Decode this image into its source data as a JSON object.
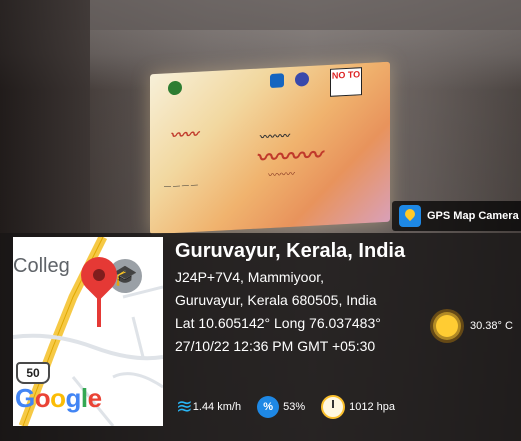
{
  "badge": {
    "app_name": "GPS Map Camera"
  },
  "map": {
    "place_label": "Colleg",
    "road_number": "50",
    "brand": {
      "g1": "G",
      "g2": "o",
      "g3": "o",
      "g4": "g",
      "g5": "l",
      "g6": "e"
    }
  },
  "location": {
    "title": "Guruvayur, Kerala, India",
    "line1": "J24P+7V4, Mammiyoor,",
    "line2": "Guruvayur, Kerala 680505, India",
    "coords": "Lat 10.605142° Long 76.037483°",
    "datetime": "27/10/22 12:36 PM GMT +05:30"
  },
  "weather": {
    "temperature": "30.38° C"
  },
  "metrics": {
    "wind": "1.44 km/h",
    "humidity": "53%",
    "humidity_icon": "%",
    "pressure": "1012 hpa"
  },
  "screen": {
    "no_logo": "NO TO",
    "colors": {
      "accent": "#c0392b",
      "overlay": "#191616"
    }
  }
}
